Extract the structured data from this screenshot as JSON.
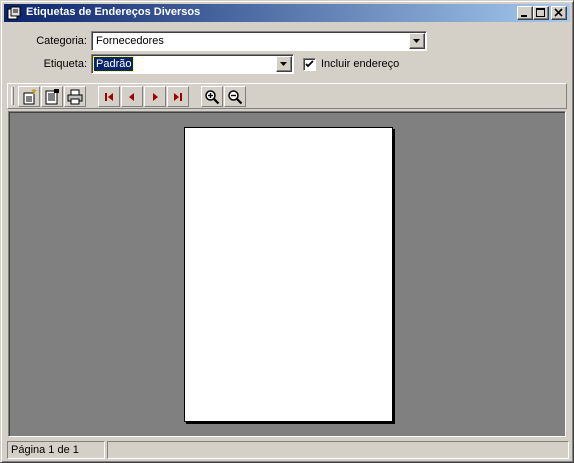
{
  "window": {
    "title": "Etiquetas de Endereços Diversos",
    "icon": "labels-app-icon",
    "caption_buttons": [
      "minimize-icon",
      "maximize-icon",
      "close-icon"
    ]
  },
  "form": {
    "categoria_label": "Categoria:",
    "categoria_value": "Fornecedores",
    "etiqueta_label": "Etiqueta:",
    "etiqueta_value": "Padrão",
    "incluir_label": "Incluir endereço",
    "incluir_checked": true
  },
  "toolbar": {
    "buttons": [
      "new-page-icon",
      "page-setup-icon",
      "print-icon",
      "first-page-icon",
      "previous-page-icon",
      "next-page-icon",
      "last-page-icon",
      "zoom-in-icon",
      "zoom-out-icon"
    ]
  },
  "colors": {
    "title_gradient_start": "#0a246a",
    "title_gradient_end": "#a6caf0",
    "navigation_arrow": "#a00000",
    "preview_background": "#808080"
  },
  "status": {
    "page_text": "Página 1 de 1"
  }
}
